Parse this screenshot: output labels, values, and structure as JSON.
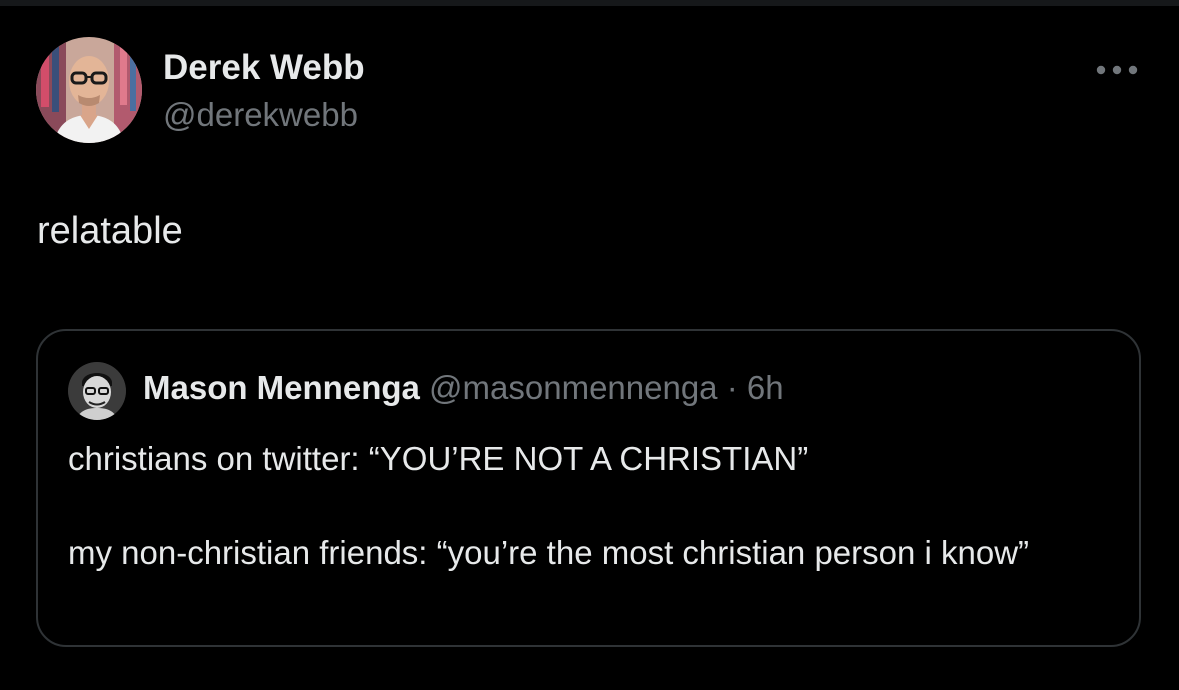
{
  "tweet": {
    "author": {
      "name": "Derek Webb",
      "handle": "@derekwebb"
    },
    "more_icon": "more-horizontal-icon",
    "text": "relatable"
  },
  "quote": {
    "author": {
      "name": "Mason Mennenga",
      "handle": "@masonmennenga",
      "separator": "·",
      "time": "6h"
    },
    "lines": [
      "christians on twitter: “YOU’RE NOT A CHRISTIAN”",
      "my non-christian friends: “you’re the most christian person i know”"
    ]
  },
  "colors": {
    "background": "#000000",
    "primary_text": "#e7e9ea",
    "secondary_text": "#71767b",
    "border": "#2f3336"
  }
}
